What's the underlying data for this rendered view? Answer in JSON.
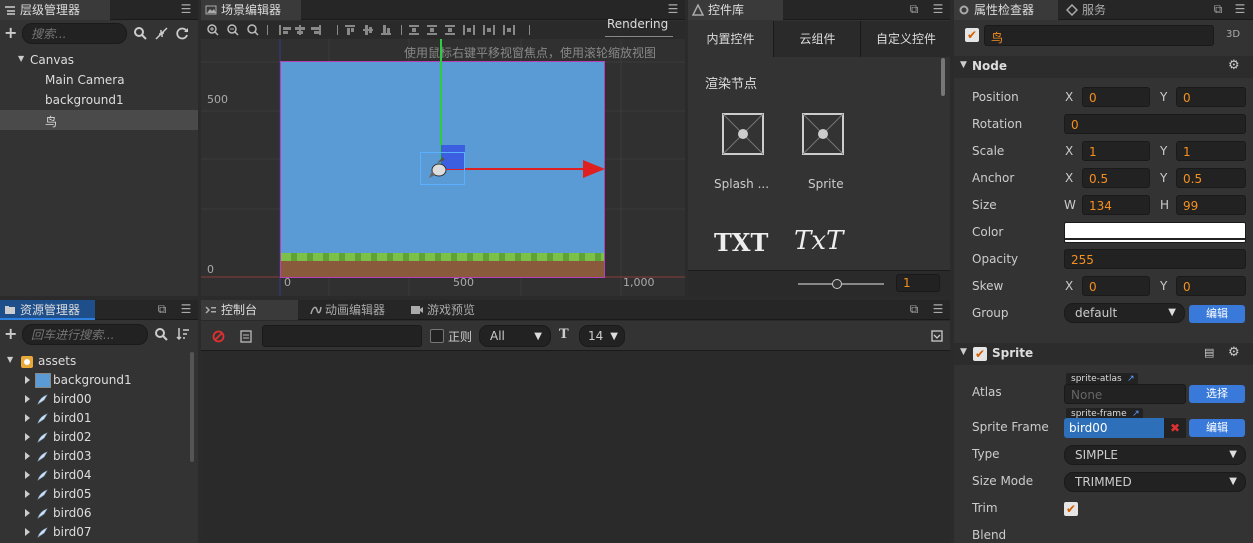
{
  "hierarchy": {
    "tab": "层级管理器",
    "search_placeholder": "搜索...",
    "nodes": [
      {
        "label": "Canvas",
        "indent": 0,
        "expanded": true,
        "selected": false
      },
      {
        "label": "Main Camera",
        "indent": 1,
        "selected": false
      },
      {
        "label": "background1",
        "indent": 1,
        "selected": false
      },
      {
        "label": "鸟",
        "indent": 1,
        "selected": true
      }
    ]
  },
  "scene": {
    "tab": "场景编辑器",
    "rendering_label": "Rendering",
    "hint": "使用鼠标右键平移视窗焦点，使用滚轮缩放视图",
    "y_labels": [
      "500",
      "0"
    ],
    "x_labels": [
      "0",
      "500",
      "1,000"
    ]
  },
  "widgets": {
    "tab": "控件库",
    "subtabs": [
      "内置控件",
      "云组件",
      "自定义控件"
    ],
    "section": "渲染节点",
    "items": [
      "Splash ...",
      "Sprite"
    ],
    "txt_labels": [
      "TXT",
      "TxT"
    ],
    "slider_value": "1"
  },
  "inspector": {
    "tab": "属性检查器",
    "tab2": "服务",
    "node_name": "鸟",
    "badge_3d": "3D",
    "node_section": "Node",
    "props": {
      "position": {
        "label": "Position",
        "x": "0",
        "y": "0"
      },
      "rotation": {
        "label": "Rotation",
        "v": "0"
      },
      "scale": {
        "label": "Scale",
        "x": "1",
        "y": "1"
      },
      "anchor": {
        "label": "Anchor",
        "x": "0.5",
        "y": "0.5"
      },
      "size": {
        "label": "Size",
        "w": "134",
        "h": "99"
      },
      "color": {
        "label": "Color"
      },
      "opacity": {
        "label": "Opacity",
        "v": "255"
      },
      "skew": {
        "label": "Skew",
        "x": "0",
        "y": "0"
      },
      "group": {
        "label": "Group",
        "v": "default",
        "btn": "编辑"
      }
    },
    "axis": {
      "x": "X",
      "y": "Y",
      "w": "W",
      "h": "H"
    },
    "sprite_section": "Sprite",
    "sprite": {
      "atlas_label": "Atlas",
      "atlas_tag": "sprite-atlas",
      "atlas_value": "None",
      "atlas_btn": "选择",
      "frame_label": "Sprite Frame",
      "frame_tag": "sprite-frame",
      "frame_value": "bird00",
      "frame_btn": "编辑",
      "type_label": "Type",
      "type_value": "SIMPLE",
      "sizemode_label": "Size Mode",
      "sizemode_value": "TRIMMED",
      "trim_label": "Trim",
      "blend_label": "Blend"
    }
  },
  "assets": {
    "tab": "资源管理器",
    "search_placeholder": "回车进行搜索...",
    "root": "assets",
    "items": [
      "background1",
      "bird00",
      "bird01",
      "bird02",
      "bird03",
      "bird04",
      "bird05",
      "bird06",
      "bird07"
    ]
  },
  "console": {
    "tabs": [
      "控制台",
      "动画编辑器",
      "游戏预览"
    ],
    "regex_label": "正则",
    "level_value": "All",
    "font_size": "14"
  },
  "colors": {
    "accent": "#2d7fe0",
    "orange": "#f59020",
    "scene_bg": "#5b9bd5",
    "grass": "#6cab3b",
    "dirt": "#8a5a3c"
  }
}
